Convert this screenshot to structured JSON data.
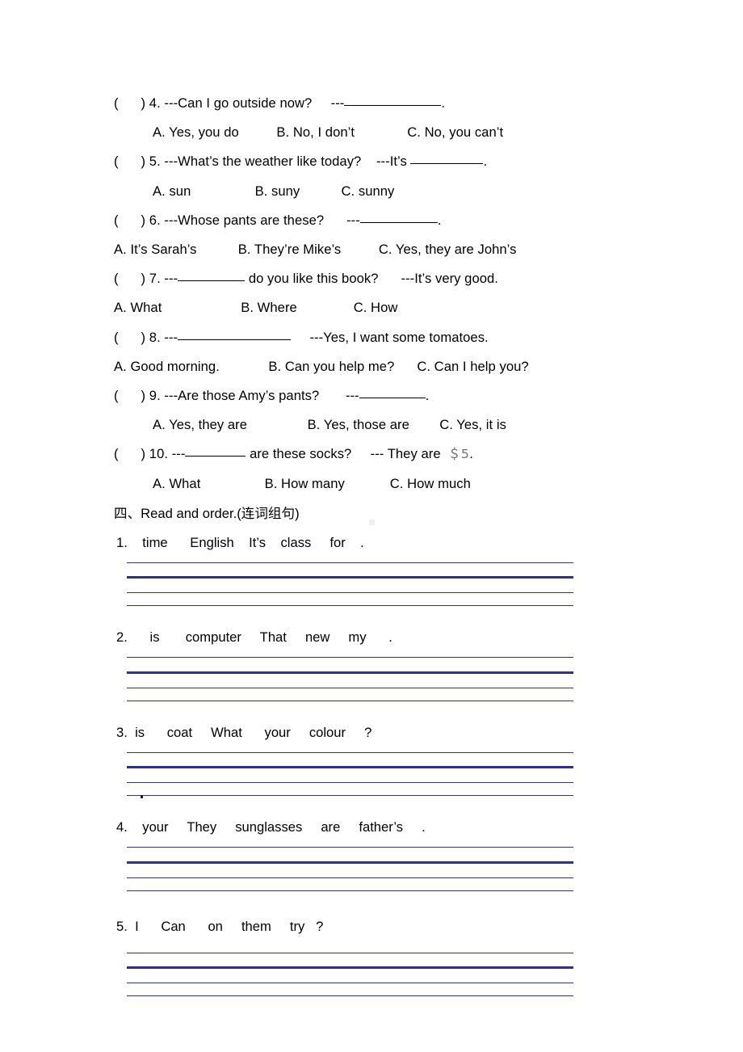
{
  "worksheet": {
    "multiple_choice": [
      {
        "bracket": "(      )",
        "number": "4.",
        "prompt": "---Can I go outside now?",
        "answer_lead": "---",
        "blank_width": 120,
        "trailing": ".",
        "options_indent": "indent",
        "options": "A. Yes, you do          B. No, I don’t              C. No, you can’t"
      },
      {
        "bracket": "(      )",
        "number": "5.",
        "prompt": "---What’s the weather like today?",
        "answer_lead": "---It’s ",
        "blank_width": 90,
        "trailing": ".",
        "options_indent": "indent",
        "options": "A. sun                 B. suny           C. sunny"
      },
      {
        "bracket": "(      )",
        "number": "6.",
        "prompt": "---Whose pants are these?",
        "answer_lead": "---",
        "blank_width": 96,
        "trailing": ".",
        "options_indent": "flush",
        "options": "A. It’s Sarah’s           B. They’re Mike’s          C. Yes, they are John’s"
      },
      {
        "bracket": "(      )",
        "number": "7.",
        "prompt_lead": "---",
        "blank_width": 83,
        "prompt_tail": " do you like this book?",
        "answer_lead": "      ---It’s very good.",
        "options_indent": "flush",
        "options": "A. What                     B. Where               C. How"
      },
      {
        "bracket": "(      )",
        "number": "8.",
        "prompt_lead": "---",
        "blank_width": 140,
        "prompt_tail": "",
        "answer_lead": "     ---Yes, I want some tomatoes.",
        "options_indent": "flush",
        "options": "A. Good morning.             B. Can you help me?      C. Can I help you?"
      },
      {
        "bracket": "(      )",
        "number": "9.",
        "prompt": "---Are those Amy’s pants?",
        "answer_lead": "---",
        "blank_width": 82,
        "trailing": ".",
        "options_indent": "indent",
        "options": "A. Yes, they are                B. Yes, those are        C. Yes, it is"
      },
      {
        "bracket": "(      )",
        "number": "10.",
        "prompt_lead": "---",
        "blank_width": 75,
        "prompt_tail": " are these socks?",
        "answer_lead": "     --- They are  ",
        "money": "＄5",
        "trailing": ".",
        "options_indent": "indent",
        "options": "A. What                 B. How many            C. How much"
      }
    ],
    "section": {
      "heading": "四、Read and order.(连词组句)"
    },
    "order_items": [
      {
        "number": "1.",
        "words": "    time      English    It’s    class     for    ."
      },
      {
        "number": "2.",
        "words": "      is       computer     That     new     my      ."
      },
      {
        "number": "3.",
        "words": "  is      coat     What      your     colour     ?"
      },
      {
        "number": "4.",
        "words": "    your     They     sunglasses     are     father’s     ."
      },
      {
        "number": "5.",
        "words": "  I      Can      on     them     try   ?"
      }
    ],
    "colors": {
      "rule": "#2f3190",
      "text": "#000000",
      "money": "#6d6d6d"
    }
  }
}
